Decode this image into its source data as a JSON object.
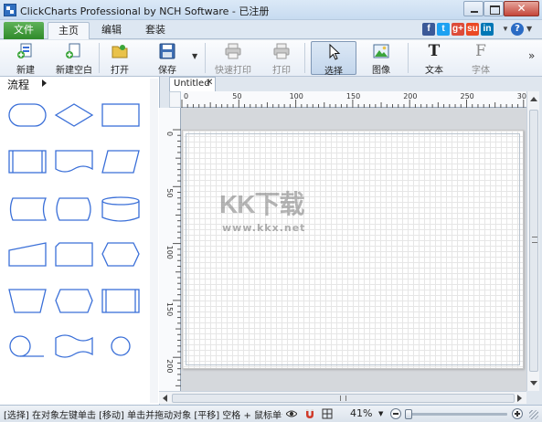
{
  "window": {
    "title": "ClickCharts Professional by NCH Software - 已注册"
  },
  "menu": {
    "file": "文件",
    "tabs": [
      "主页",
      "编辑",
      "套装"
    ]
  },
  "social": {
    "facebook": "f",
    "twitter": "t",
    "google": "g+",
    "stumble": "su",
    "linkedin": "in",
    "help": "?"
  },
  "toolbar": {
    "new": "新建",
    "new_blank": "新建空白",
    "open": "打开",
    "save": "保存",
    "quick_print": "快速打印",
    "print": "打印",
    "select": "选择",
    "image": "图像",
    "text": "文本",
    "text_glyph": "T",
    "font": "字体",
    "font_glyph": "F"
  },
  "panel": {
    "title": "流程"
  },
  "document": {
    "tab_title": "Untitled"
  },
  "rulers": {
    "top": [
      "0",
      "50",
      "100",
      "150",
      "200",
      "250",
      "30"
    ],
    "left": [
      "0",
      "50",
      "100",
      "150",
      "200"
    ]
  },
  "watermark": {
    "logo": "KK下载",
    "url": "www.kkx.net"
  },
  "status": {
    "text": "[选择] 在对象左键单击 [移动] 单击并拖动对象 [平移] 空格 + 鼠标单击并",
    "zoom": "41%"
  },
  "colors": {
    "accent": "#2f8a2a",
    "shape_stroke": "#3a6fd8"
  }
}
